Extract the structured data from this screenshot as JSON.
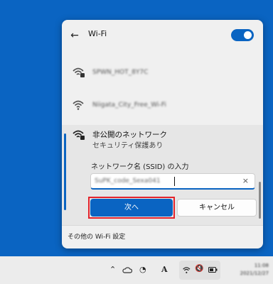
{
  "header": {
    "back_icon": "back-arrow-icon",
    "title": "Wi-Fi",
    "wifi_toggle": "on"
  },
  "networks": [
    {
      "name": "SPWN_HOT_8Y7C",
      "secured": true
    },
    {
      "name": "Niigata_City_Free_Wi-Fi",
      "secured": false
    }
  ],
  "hidden_network": {
    "name": "非公開のネットワーク",
    "security": "セキュリティ保護あり",
    "ssid_label": "ネットワーク名 (SSID) の入力",
    "ssid_value": "SuPK_code_Sexa041",
    "next_label": "次へ",
    "cancel_label": "キャンセル"
  },
  "footer": {
    "more_settings": "その他の Wi-Fi 設定"
  },
  "taskbar": {
    "icons": [
      "chevron-up-icon",
      "onedrive-cloud-icon",
      "volume-app-icon",
      "font-app-icon",
      "wifi-icon",
      "speaker-muted-icon",
      "battery-icon"
    ],
    "time": "11:08",
    "date": "2021/12/27"
  },
  "colors": {
    "accent": "#0a64c2",
    "highlight": "#e3232c",
    "desktop": "#0a64c2"
  }
}
